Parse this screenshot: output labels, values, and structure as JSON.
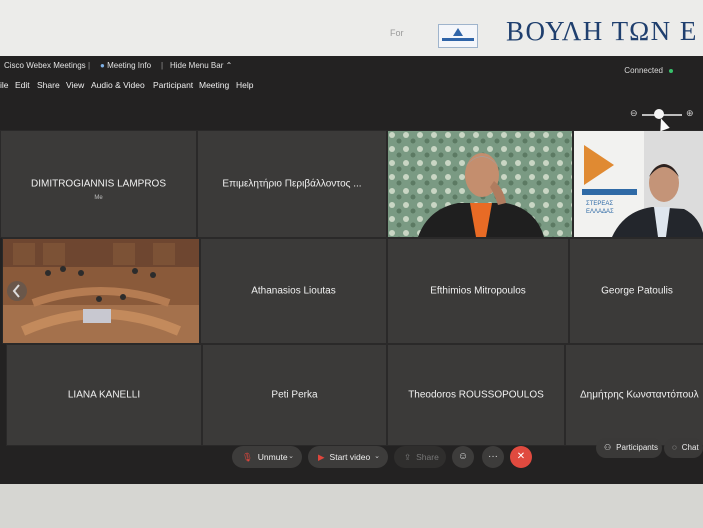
{
  "above": {
    "for_label": "For",
    "parliament": "ΒΟΥΛΗ ΤΩΝ Ε"
  },
  "titlebar": {
    "app": "Cisco Webex Meetings",
    "meeting_info": "Meeting Info",
    "hide_menu": "Hide Menu Bar",
    "connected": "Connected"
  },
  "menu": [
    "ile",
    "Edit",
    "Share",
    "View",
    "Audio & Video",
    "Participant",
    "Meeting",
    "Help"
  ],
  "zoom": {
    "minus": "⊖",
    "plus": "⊕"
  },
  "participants": [
    {
      "name": "DIMITROGIANNIS LAMPROS",
      "sub": "Me"
    },
    {
      "name": "Επιμελητήριο Περιβάλλοντος ..."
    },
    {
      "name": ""
    },
    {
      "name": ""
    },
    {
      "name": ""
    },
    {
      "name": "Athanasios Lioutas"
    },
    {
      "name": "Efthimios Mitropoulos"
    },
    {
      "name": "George Patoulis"
    },
    {
      "name": "LIANA KANELLI"
    },
    {
      "name": "Peti Perka"
    },
    {
      "name": "Theodoros ROUSSOPOULOS"
    },
    {
      "name": "Δημήτρης Κωνσταντόπουλ"
    }
  ],
  "video_texts": {
    "banner_a": "ΣΤΕΡΕΑΣ",
    "banner_b": "ΕΛΛΑΔΑΣ"
  },
  "controls": {
    "unmute": "Unmute",
    "start_video": "Start video",
    "share": "Share",
    "participants": "Participants",
    "chat": "Chat"
  },
  "icons": {
    "mic": "microphone-icon",
    "camera": "camera-icon",
    "share": "share-icon",
    "emoji": "emoji-icon",
    "more": "more-icon",
    "leave": "close-icon"
  },
  "colors": {
    "leave": "#e04a3f",
    "connected": "#38c06b",
    "window_bg": "#232222",
    "tile_bg": "#3b3a39"
  }
}
